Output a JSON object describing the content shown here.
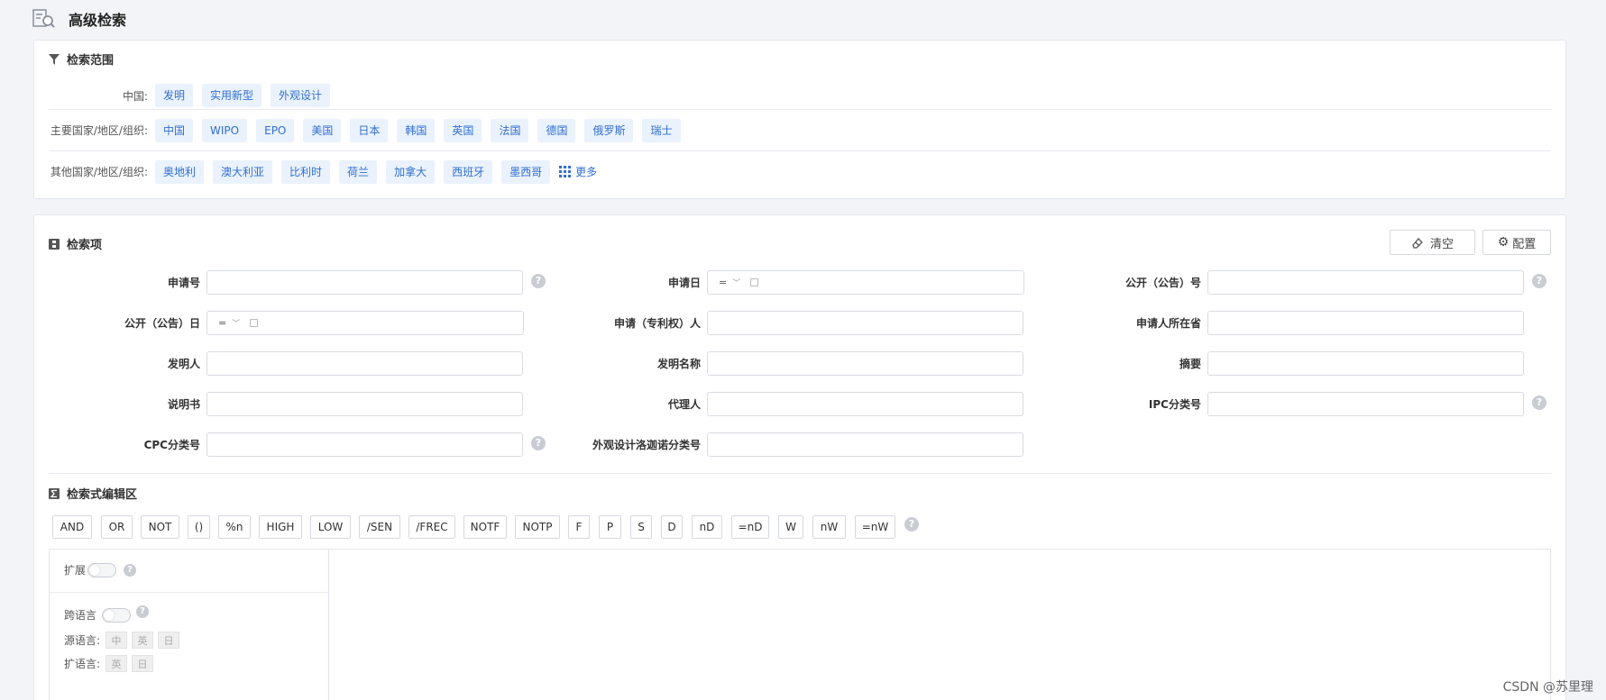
{
  "header": {
    "title": "高级检索",
    "icon": "search-document-icon"
  },
  "scope": {
    "title": "检索范围",
    "rows": [
      {
        "label": "中国:",
        "tags": [
          "发明",
          "实用新型",
          "外观设计"
        ]
      },
      {
        "label": "主要国家/地区/组织:",
        "tags": [
          "中国",
          "WIPO",
          "EPO",
          "美国",
          "日本",
          "韩国",
          "英国",
          "法国",
          "德国",
          "俄罗斯",
          "瑞士"
        ]
      },
      {
        "label": "其他国家/地区/组织:",
        "tags": [
          "奥地利",
          "澳大利亚",
          "比利时",
          "荷兰",
          "加拿大",
          "西班牙",
          "墨西哥"
        ],
        "more": "更多"
      }
    ]
  },
  "search_items": {
    "title": "检索项",
    "clear_label": "清空",
    "config_label": "配置",
    "fields": [
      {
        "label": "申请号",
        "type": "text",
        "help": true
      },
      {
        "label": "申请日",
        "type": "date",
        "op": "="
      },
      {
        "label": "公开（公告）号",
        "type": "text",
        "help": true
      },
      {
        "label": "公开（公告）日",
        "type": "date",
        "op": "="
      },
      {
        "label": "申请（专利权）人",
        "type": "text"
      },
      {
        "label": "申请人所在省",
        "type": "text"
      },
      {
        "label": "发明人",
        "type": "text"
      },
      {
        "label": "发明名称",
        "type": "text"
      },
      {
        "label": "摘要",
        "type": "text"
      },
      {
        "label": "说明书",
        "type": "text"
      },
      {
        "label": "代理人",
        "type": "text"
      },
      {
        "label": "IPC分类号",
        "type": "text",
        "help": true
      },
      {
        "label": "CPC分类号",
        "type": "text",
        "help": true
      },
      {
        "label": "外观设计洛迦诺分类号",
        "type": "text"
      }
    ]
  },
  "editor": {
    "title": "检索式编辑区",
    "operators": [
      "AND",
      "OR",
      "NOT",
      "()",
      "%n",
      "HIGH",
      "LOW",
      "/SEN",
      "/FREC",
      "NOTF",
      "NOTP",
      "F",
      "P",
      "S",
      "D",
      "nD",
      "=nD",
      "W",
      "nW",
      "=nW"
    ],
    "expand_label": "扩展",
    "cross_lang_label": "跨语言",
    "source_lang_label": "源语言:",
    "source_langs": [
      "中",
      "英",
      "日"
    ],
    "expand_lang_label": "扩语言:",
    "expand_langs": [
      "英",
      "日"
    ]
  },
  "help_glyph": "?",
  "watermark": "CSDN @苏里理",
  "colors": {
    "accent": "#2f6fd3",
    "tag_bg": "#eaf2fd",
    "page_bg": "#f2f4f8"
  }
}
